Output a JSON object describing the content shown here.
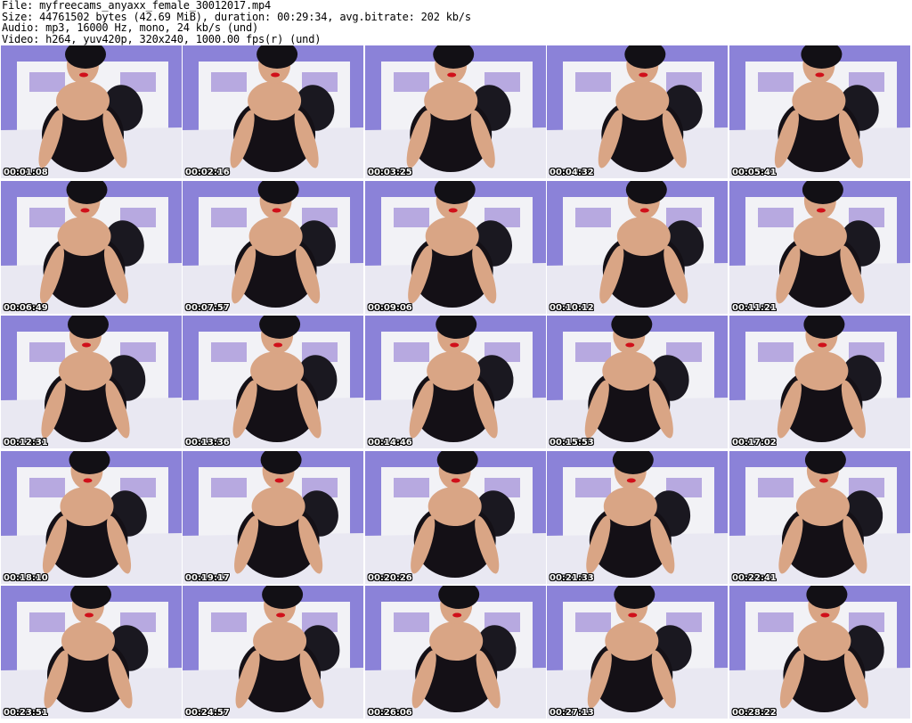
{
  "header": {
    "file": "File: myfreecams_anyaxx_female_30012017.mp4",
    "size": "Size: 44761502 bytes (42.69 MiB), duration: 00:29:34, avg.bitrate: 202 kb/s",
    "audio": "Audio: mp3, 16000 Hz, mono, 24 kb/s (und)",
    "video": "Video: h264, yuv420p, 320x240, 1000.00 fps(r) (und)"
  },
  "colors": {
    "wall": "#8b82d8",
    "headboard": "#f2f2f6",
    "headboard_panel": "#b7a9e0",
    "bed": "#e9e8f2",
    "outfit": "#141016",
    "skin": "#d9a585",
    "hair": "#121015"
  },
  "thumbnails": [
    {
      "time": "00:01:08"
    },
    {
      "time": "00:02:16"
    },
    {
      "time": "00:03:25"
    },
    {
      "time": "00:04:32"
    },
    {
      "time": "00:05:41"
    },
    {
      "time": "00:06:49"
    },
    {
      "time": "00:07:57"
    },
    {
      "time": "00:09:06"
    },
    {
      "time": "00:10:12"
    },
    {
      "time": "00:11:21"
    },
    {
      "time": "00:12:31"
    },
    {
      "time": "00:13:36"
    },
    {
      "time": "00:14:46"
    },
    {
      "time": "00:15:53"
    },
    {
      "time": "00:17:02"
    },
    {
      "time": "00:18:10"
    },
    {
      "time": "00:19:17"
    },
    {
      "time": "00:20:26"
    },
    {
      "time": "00:21:33"
    },
    {
      "time": "00:22:41"
    },
    {
      "time": "00:23:51"
    },
    {
      "time": "00:24:57"
    },
    {
      "time": "00:26:06"
    },
    {
      "time": "00:27:13"
    },
    {
      "time": "00:28:22"
    }
  ]
}
